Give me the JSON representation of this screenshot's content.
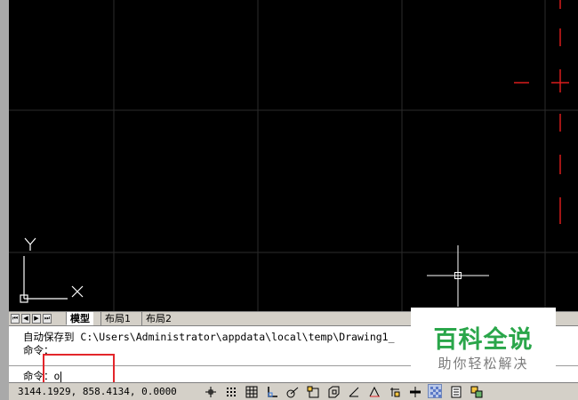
{
  "layout_tabs": {
    "model": "模型",
    "layout1": "布局1",
    "layout2": "布局2"
  },
  "tab_nav": {
    "first": "⏮",
    "prev": "◀",
    "next": "▶",
    "last": "⏭"
  },
  "ucs": {
    "x_label": "X",
    "y_label": "Y"
  },
  "command": {
    "history_line1": "自动保存到 C:\\Users\\Administrator\\appdata\\local\\temp\\Drawing1_",
    "history_line2": "命令：",
    "prompt": "命令：",
    "input_value": "o"
  },
  "status": {
    "coordinates": "3144.1929, 858.4134, 0.0000",
    "buttons": [
      {
        "icon": "infer-constraints-icon",
        "on": false
      },
      {
        "icon": "snap-mode-icon",
        "on": false
      },
      {
        "icon": "grid-display-icon",
        "on": false
      },
      {
        "icon": "ortho-mode-icon",
        "on": false
      },
      {
        "icon": "polar-tracking-icon",
        "on": false
      },
      {
        "icon": "object-snap-icon",
        "on": false
      },
      {
        "icon": "3d-object-snap-icon",
        "on": false
      },
      {
        "icon": "object-snap-tracking-icon",
        "on": false
      },
      {
        "icon": "dynamic-ucs-icon",
        "on": false
      },
      {
        "icon": "dynamic-input-icon",
        "on": false
      },
      {
        "icon": "lineweight-icon",
        "on": false
      },
      {
        "icon": "transparency-icon",
        "on": true
      },
      {
        "icon": "quick-properties-icon",
        "on": false
      },
      {
        "icon": "selection-cycling-icon",
        "on": false
      }
    ]
  },
  "watermark": {
    "title": "百科全说",
    "subtitle": "助你轻松解决"
  },
  "colors": {
    "canvas": "#000000",
    "grid": "#2b2b2b",
    "construction_line": "#d91c1c",
    "crosshair": "#ffffff",
    "highlight_box": "#e3262b",
    "watermark_green": "#2aa64a"
  }
}
